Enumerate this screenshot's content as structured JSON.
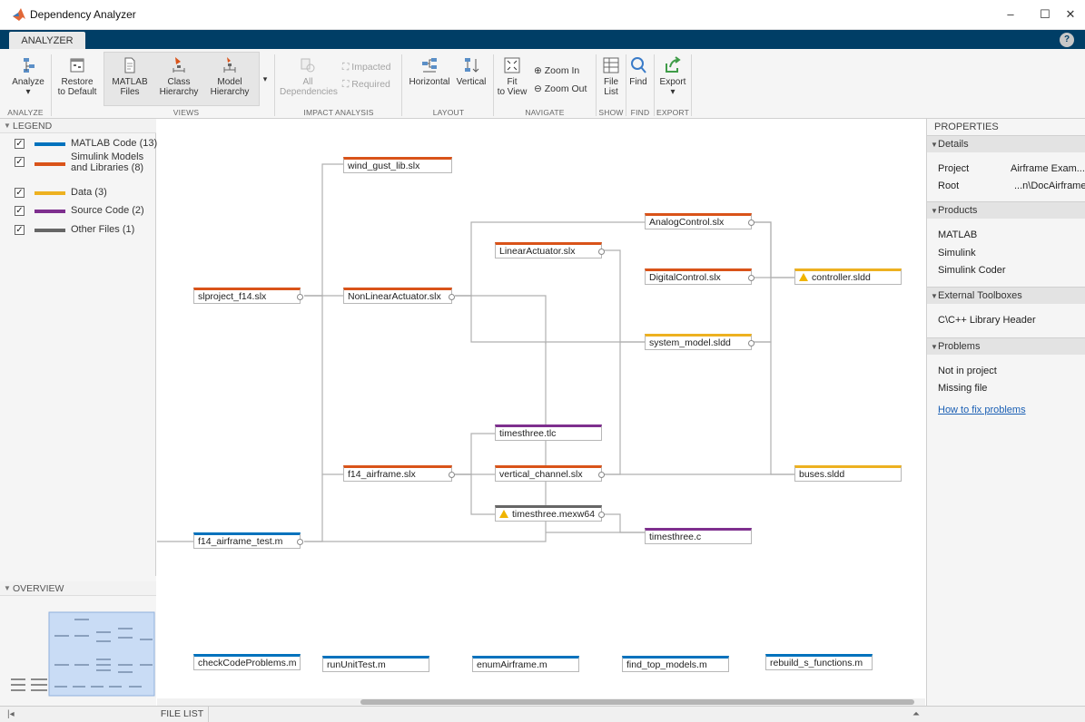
{
  "window": {
    "title": "Dependency Analyzer",
    "minimize": "–",
    "maximize": "☐",
    "close": "✕"
  },
  "tabs": {
    "analyzer": "ANALYZER",
    "help": "?"
  },
  "ribbon": {
    "analyze": "Analyze",
    "restore": [
      "Restore",
      "to Default"
    ],
    "matlab_files": [
      "MATLAB",
      "Files"
    ],
    "class_hierarchy": [
      "Class",
      "Hierarchy"
    ],
    "model_hierarchy": [
      "Model",
      "Hierarchy"
    ],
    "all_dependencies": [
      "All",
      "Dependencies"
    ],
    "impacted": "Impacted",
    "required": "Required",
    "horizontal": "Horizontal",
    "vertical": "Vertical",
    "fit_to_view": [
      "Fit",
      "to View"
    ],
    "zoom_in": "Zoom In",
    "zoom_out": "Zoom Out",
    "file_list": [
      "File",
      "List"
    ],
    "find": "Find",
    "export": "Export",
    "sections": {
      "analyze": "ANALYZE",
      "views": "VIEWS",
      "impact": "IMPACT ANALYSIS",
      "layout": "LAYOUT",
      "navigate": "NAVIGATE",
      "show": "SHOW",
      "find": "FIND",
      "export": "EXPORT"
    }
  },
  "legend": {
    "title": "LEGEND",
    "items": [
      {
        "label": "MATLAB Code (13)",
        "color": "#0072bd"
      },
      {
        "label": "Simulink Models\nand Libraries (8)",
        "color": "#d95319"
      },
      {
        "label": "Data (3)",
        "color": "#edb120"
      },
      {
        "label": "Source Code (2)",
        "color": "#7e2f8e"
      },
      {
        "label": "Other Files (1)",
        "color": "#666666"
      }
    ]
  },
  "overview": {
    "title": "OVERVIEW"
  },
  "nodes": {
    "wind_gust_lib": "wind_gust_lib.slx",
    "slproject_f14": "slproject_f14.slx",
    "nonlinearactuator": "NonLinearActuator.slx",
    "analogcontrol": "AnalogControl.slx",
    "linearactuator": "LinearActuator.slx",
    "digitalcontrol": "DigitalControl.slx",
    "controller": "controller.sldd",
    "system_model": "system_model.sldd",
    "timesthree_tlc": "timesthree.tlc",
    "f14_airframe": "f14_airframe.slx",
    "vertical_channel": "vertical_channel.slx",
    "buses": "buses.sldd",
    "timesthree_mexw64": "timesthree.mexw64",
    "f14_airframe_test": "f14_airframe_test.m",
    "timesthree_c": "timesthree.c",
    "checkcodeproblems": "checkCodeProblems.m",
    "rununittest": "runUnitTest.m",
    "enumairframe": "enumAirframe.m",
    "find_top_models": "find_top_models.m",
    "rebuild_s_functions": "rebuild_s_functions.m"
  },
  "properties": {
    "title": "PROPERTIES",
    "details": "Details",
    "project_label": "Project",
    "project_value": "Airframe Exam...",
    "root_label": "Root",
    "root_value": "...n\\DocAirframe",
    "products": "Products",
    "product_list": [
      "MATLAB",
      "Simulink",
      "Simulink Coder"
    ],
    "external_toolboxes": "External Toolboxes",
    "toolbox_list": [
      "C\\C++ Library Header"
    ],
    "problems": "Problems",
    "problem_list": [
      "Not in project",
      "Missing file"
    ],
    "fix_link": "How to fix problems"
  },
  "bottom": {
    "file_list": "FILE LIST",
    "left_arrow": "|◂",
    "up_arrow": "⏶"
  }
}
